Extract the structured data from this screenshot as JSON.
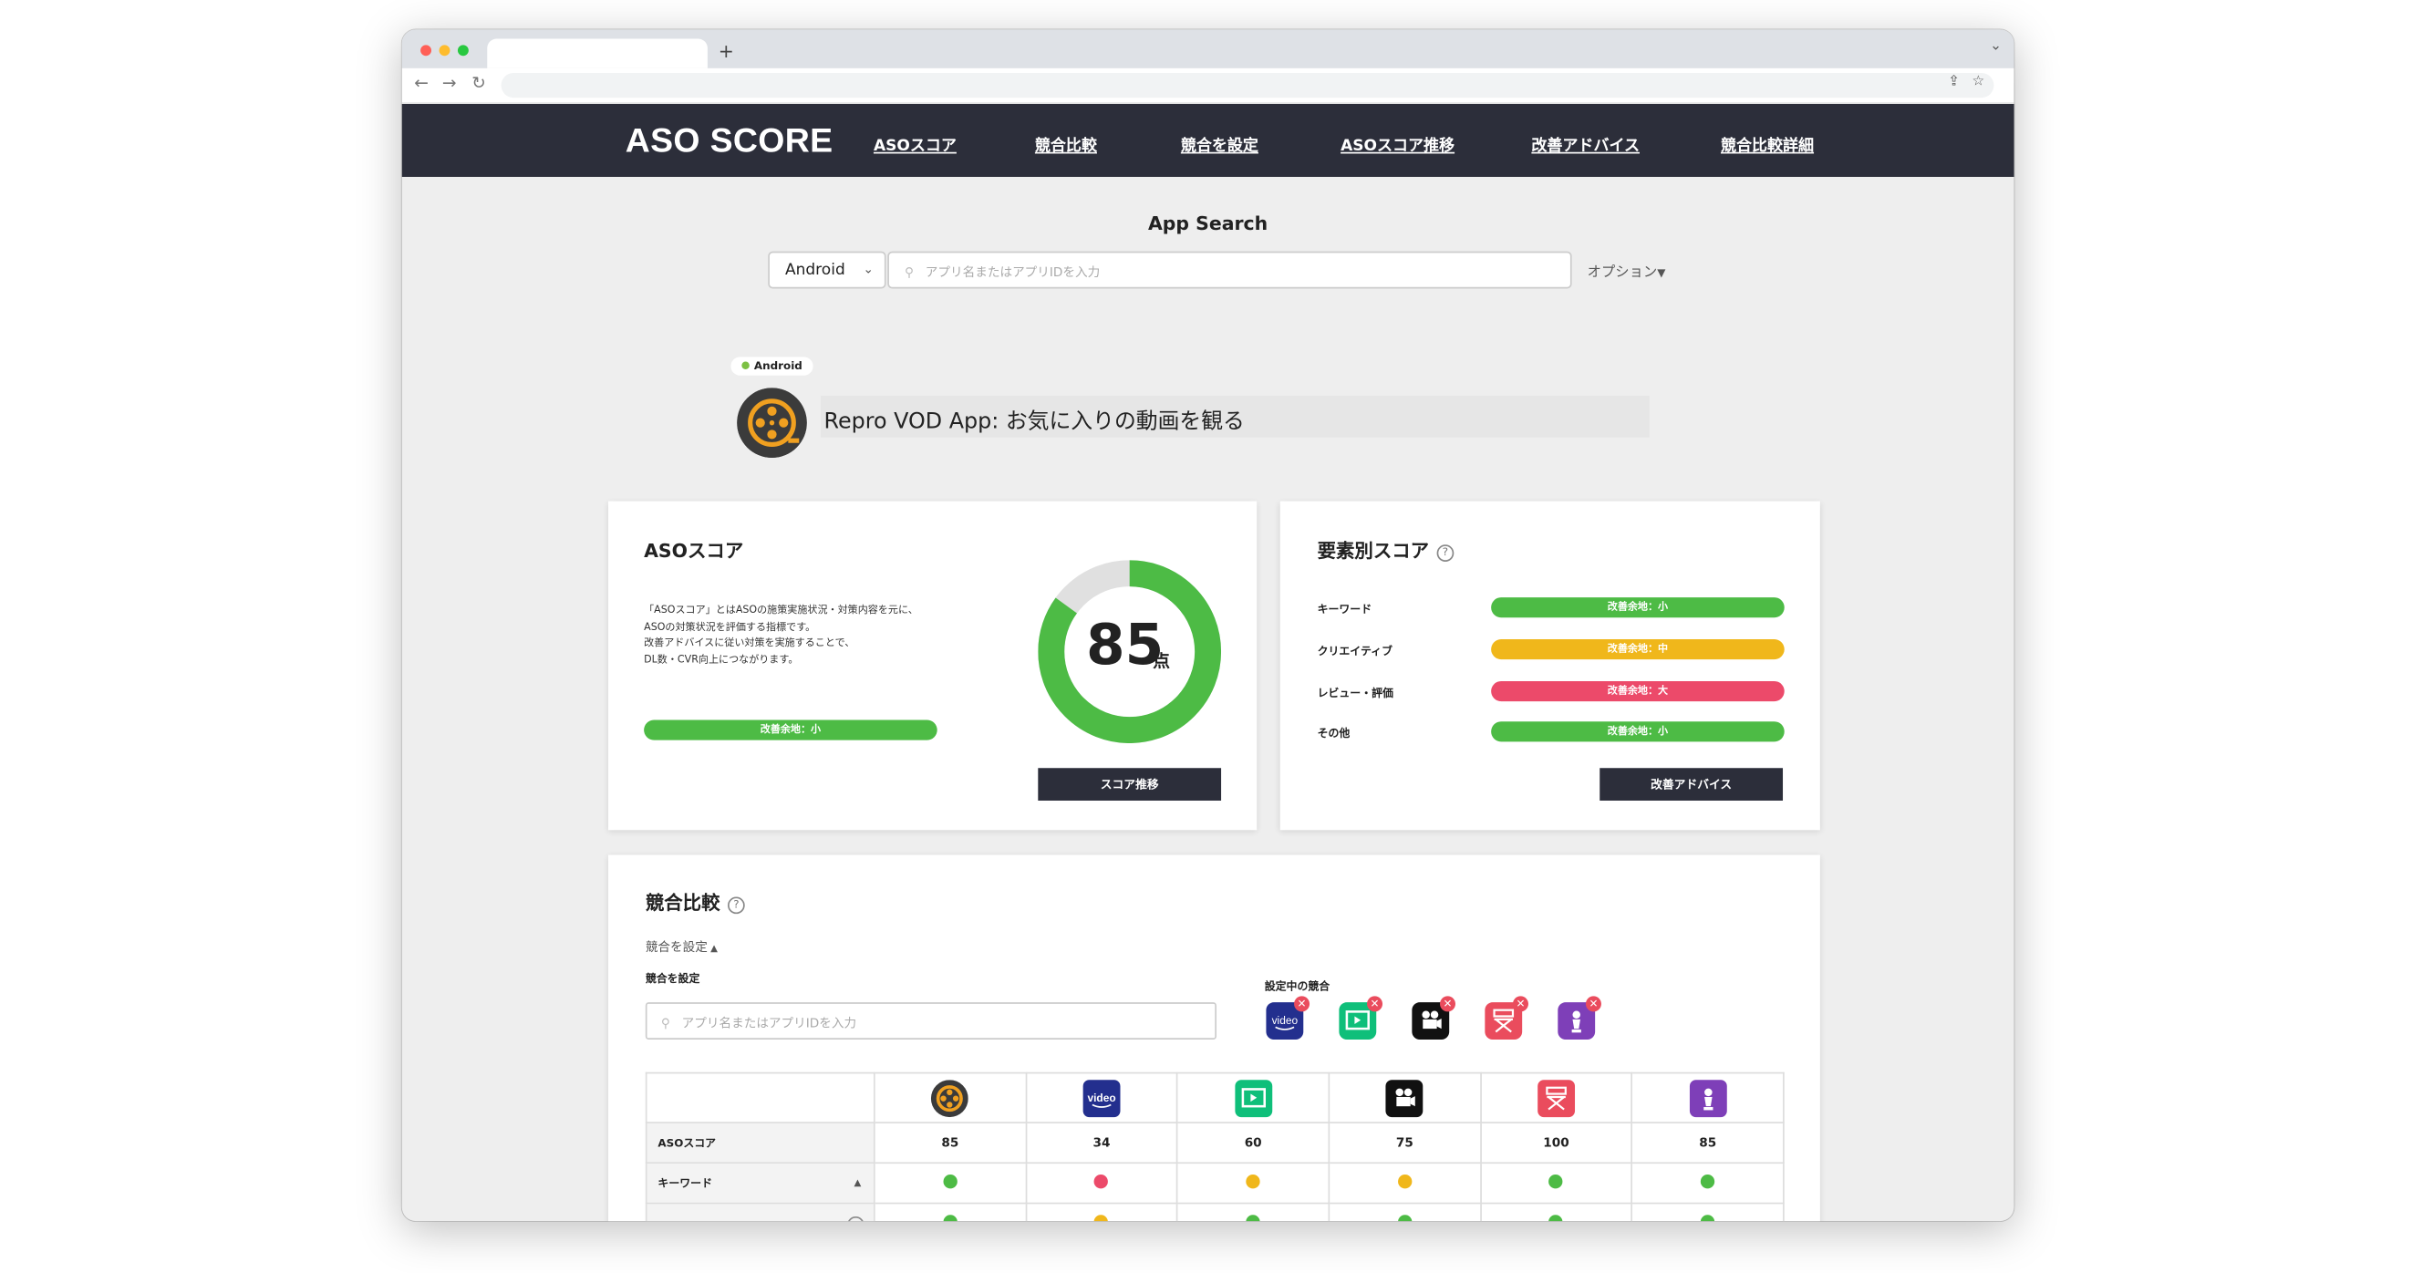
{
  "nav": {
    "logo": "ASO SCORE",
    "links": [
      "ASOスコア",
      "競合比較",
      "競合を設定",
      "ASOスコア推移",
      "改善アドバイス",
      "競合比較詳細"
    ]
  },
  "search": {
    "title": "App Search",
    "os": "Android",
    "placeholder": "アプリ名またはアプリIDを入力",
    "options": "オプション"
  },
  "app": {
    "platform": "Android",
    "name": "Repro VOD App: お気に入りの動画を観る"
  },
  "aso_card": {
    "title": "ASOスコア",
    "description": [
      "「ASOスコア」とはASOの施策実施状況・対策内容を元に、",
      "ASOの対策状況を評価する指標です。",
      "改善アドバイスに従い対策を実施することで、",
      "DL数・CVR向上につながります。"
    ],
    "status": "改善余地：小",
    "score": "85",
    "score_fraction": 0.85,
    "unit": "点",
    "button": "スコア推移"
  },
  "element_card": {
    "title": "要素別スコア",
    "help": "?",
    "rows": [
      {
        "label": "キーワード",
        "status": "改善余地：小",
        "color": "#4dbb45"
      },
      {
        "label": "クリエイティブ",
        "status": "改善余地：中",
        "color": "#f0b71b"
      },
      {
        "label": "レビュー・評価",
        "status": "改善余地：大",
        "color": "#ec4a6a"
      },
      {
        "label": "その他",
        "status": "改善余地：小",
        "color": "#4dbb45"
      }
    ],
    "button": "改善アドバイス"
  },
  "compare_card": {
    "title": "競合比較",
    "help": "?",
    "toggle": "競合を設定",
    "set_label": "競合を設定",
    "placeholder": "アプリ名またはアプリIDを入力",
    "current_label": "設定中の競合",
    "competitor_icons": [
      "prime-video-icon",
      "tv-app-icon",
      "movie-camera-app-icon",
      "director-chair-app-icon",
      "award-app-icon"
    ],
    "table": {
      "columns": [
        "repro-vod-icon",
        "prime-video-icon",
        "tv-app-icon",
        "movie-camera-app-icon",
        "director-chair-app-icon",
        "award-app-icon"
      ],
      "aso_label": "ASOスコア",
      "aso_scores": [
        "85",
        "34",
        "60",
        "75",
        "100",
        "85"
      ],
      "keyword_label": "キーワード",
      "keyword_status": [
        "good",
        "bad",
        "medium",
        "medium",
        "good",
        "good"
      ],
      "partial_row_status": [
        "good",
        "medium",
        "good",
        "good",
        "good",
        "good"
      ]
    }
  },
  "colors": {
    "nav_bg": "#2c2e3a",
    "good": "#4dbb45",
    "medium": "#f0b71b",
    "bad": "#ec4a6a",
    "ring_track": "#e0e0e0"
  }
}
